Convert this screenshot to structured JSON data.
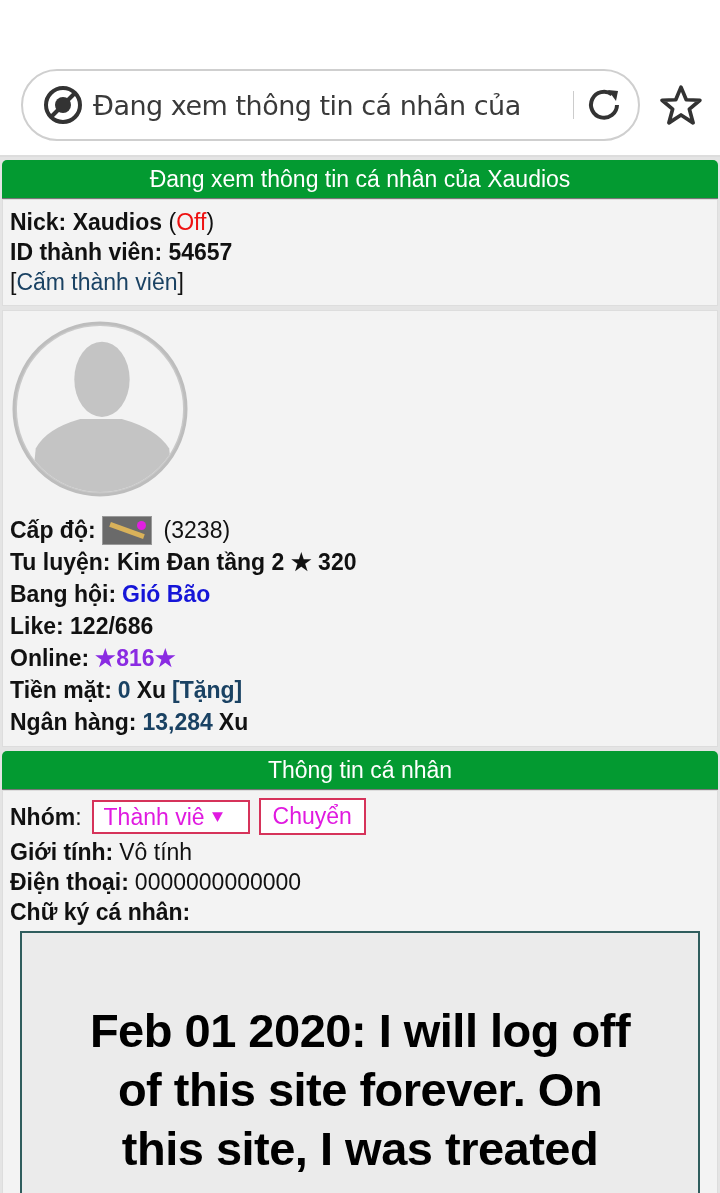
{
  "address_bar": {
    "text": "Đang xem thông tin cá nhân của"
  },
  "profile_header": {
    "title": "Đang xem thông tin cá nhân của Xaudios"
  },
  "account_lines": [
    [
      {
        "kind": "label",
        "text": "Nick: Xaudios"
      },
      {
        "kind": "plain",
        "text": " ("
      },
      {
        "kind": "status",
        "text": "Off"
      },
      {
        "kind": "plain",
        "text": ")"
      }
    ],
    [
      {
        "kind": "label",
        "text": "ID thành viên: 54657"
      }
    ],
    [
      {
        "kind": "plain",
        "text": "["
      },
      {
        "kind": "link",
        "text": "Cấm thành viên"
      },
      {
        "kind": "plain",
        "text": "]"
      }
    ]
  ],
  "stats_lines": [
    [
      {
        "kind": "label",
        "text": "Cấp độ:"
      },
      {
        "kind": "level_image"
      },
      {
        "kind": "plain",
        "text": "(3238)"
      }
    ],
    [
      {
        "kind": "label",
        "text": "Tu luyện: Kim Đan tầng 2 ★ 320"
      }
    ],
    [
      {
        "kind": "label",
        "text": "Bang hội:"
      },
      {
        "kind": "guild",
        "text": "Gió Bão"
      }
    ],
    [
      {
        "kind": "label",
        "text": "Like: 122/686"
      }
    ],
    [
      {
        "kind": "label",
        "text": "Online:"
      },
      {
        "kind": "online",
        "text": "★816★"
      }
    ],
    [
      {
        "kind": "label",
        "text": "Tiền mặt:"
      },
      {
        "kind": "amount",
        "text": "0"
      },
      {
        "kind": "label",
        "text": "Xu"
      },
      {
        "kind": "amount",
        "text": "[Tặng]"
      }
    ],
    [
      {
        "kind": "label",
        "text": "Ngân hàng:"
      },
      {
        "kind": "amount",
        "text": "13,284"
      },
      {
        "kind": "label",
        "text": "Xu"
      }
    ]
  ],
  "personal_header": {
    "title": "Thông tin cá nhân"
  },
  "group_row": {
    "label": "Nhóm",
    "colon": ":",
    "select_value": "Thành viê",
    "button": "Chuyển"
  },
  "personal_lines": [
    {
      "label": "Giới tính:",
      "value": "Vô tính"
    },
    {
      "label": "Điện thoại:",
      "value": "0000000000000"
    },
    {
      "label": "Chữ ký cá nhân:"
    }
  ],
  "signature": {
    "text": "Feb 01 2020: I will log off of this site forever. On this site, I was treated"
  }
}
